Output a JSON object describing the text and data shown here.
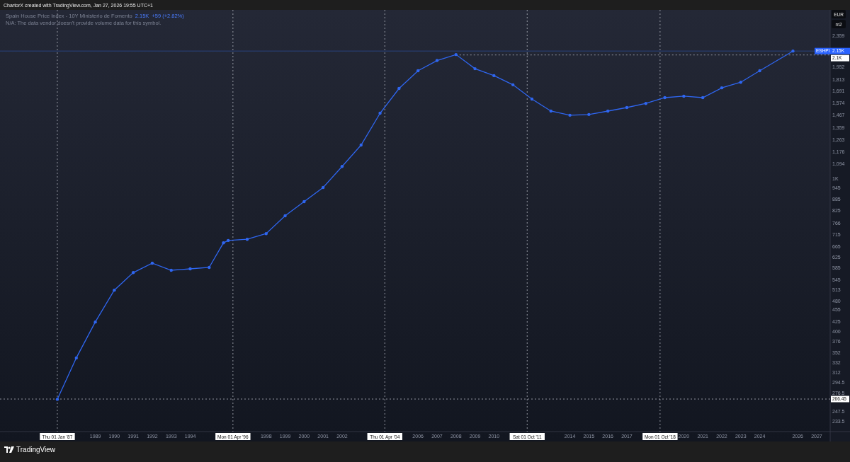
{
  "header": {
    "title": "ChartorX created with TradingView.com, Jan 27, 2026 19:55 UTC+1"
  },
  "legend": {
    "symbol": "Spain House Price Index - 10Y Ministerio de Fomento",
    "price": "2.15K",
    "change": "+59 (+2.82%)",
    "note": "N/A: The data vendor doesn't provide volume data for this symbol."
  },
  "axis_buttons": [
    "EUR",
    "m2"
  ],
  "chart": {
    "kind": "line",
    "price_scale": [
      "2,359",
      "1,952",
      "1,813",
      "1,691",
      "1,574",
      "1,467",
      "1,359",
      "1,263",
      "1,176",
      "1,094",
      "1K",
      "945",
      "885",
      "825",
      "766",
      "715",
      "665",
      "625",
      "585",
      "545",
      "513",
      "480",
      "455",
      "425",
      "400",
      "376",
      "352",
      "332",
      "312",
      "294.5",
      "276.5",
      "247.5",
      "233.5"
    ],
    "time_scale": [
      {
        "kind": "marker",
        "label": "Thu 01 Jan '87"
      },
      {
        "kind": "year",
        "label": "1989"
      },
      {
        "kind": "year",
        "label": "1990"
      },
      {
        "kind": "year",
        "label": "1991"
      },
      {
        "kind": "year",
        "label": "1992"
      },
      {
        "kind": "year",
        "label": "1993"
      },
      {
        "kind": "year",
        "label": "1994"
      },
      {
        "kind": "marker",
        "label": "Mon 01 Apr '96"
      },
      {
        "kind": "year",
        "label": "1998"
      },
      {
        "kind": "year",
        "label": "1999"
      },
      {
        "kind": "year",
        "label": "2000"
      },
      {
        "kind": "year",
        "label": "2001"
      },
      {
        "kind": "year",
        "label": "2002"
      },
      {
        "kind": "marker",
        "label": "Thu 01 Apr '04"
      },
      {
        "kind": "year",
        "label": "2006"
      },
      {
        "kind": "year",
        "label": "2007"
      },
      {
        "kind": "year",
        "label": "2008"
      },
      {
        "kind": "year",
        "label": "2009"
      },
      {
        "kind": "year",
        "label": "2010"
      },
      {
        "kind": "marker",
        "label": "Sat 01 Oct '11"
      },
      {
        "kind": "year",
        "label": "2014"
      },
      {
        "kind": "year",
        "label": "2015"
      },
      {
        "kind": "year",
        "label": "2016"
      },
      {
        "kind": "year",
        "label": "2017"
      },
      {
        "kind": "marker",
        "label": "Mon 01 Oct '18"
      },
      {
        "kind": "year",
        "label": "2020"
      },
      {
        "kind": "year",
        "label": "2021"
      },
      {
        "kind": "year",
        "label": "2022"
      },
      {
        "kind": "year",
        "label": "2023"
      },
      {
        "kind": "year",
        "label": "2024"
      },
      {
        "kind": "year",
        "label": "2026"
      },
      {
        "kind": "year",
        "label": "2027"
      }
    ],
    "price_tag": {
      "symbol": "ESHPI",
      "price": "2.15K"
    },
    "level_labels": [
      "2.1K",
      "266.45"
    ]
  },
  "footer": {
    "brand": "TradingView"
  }
}
